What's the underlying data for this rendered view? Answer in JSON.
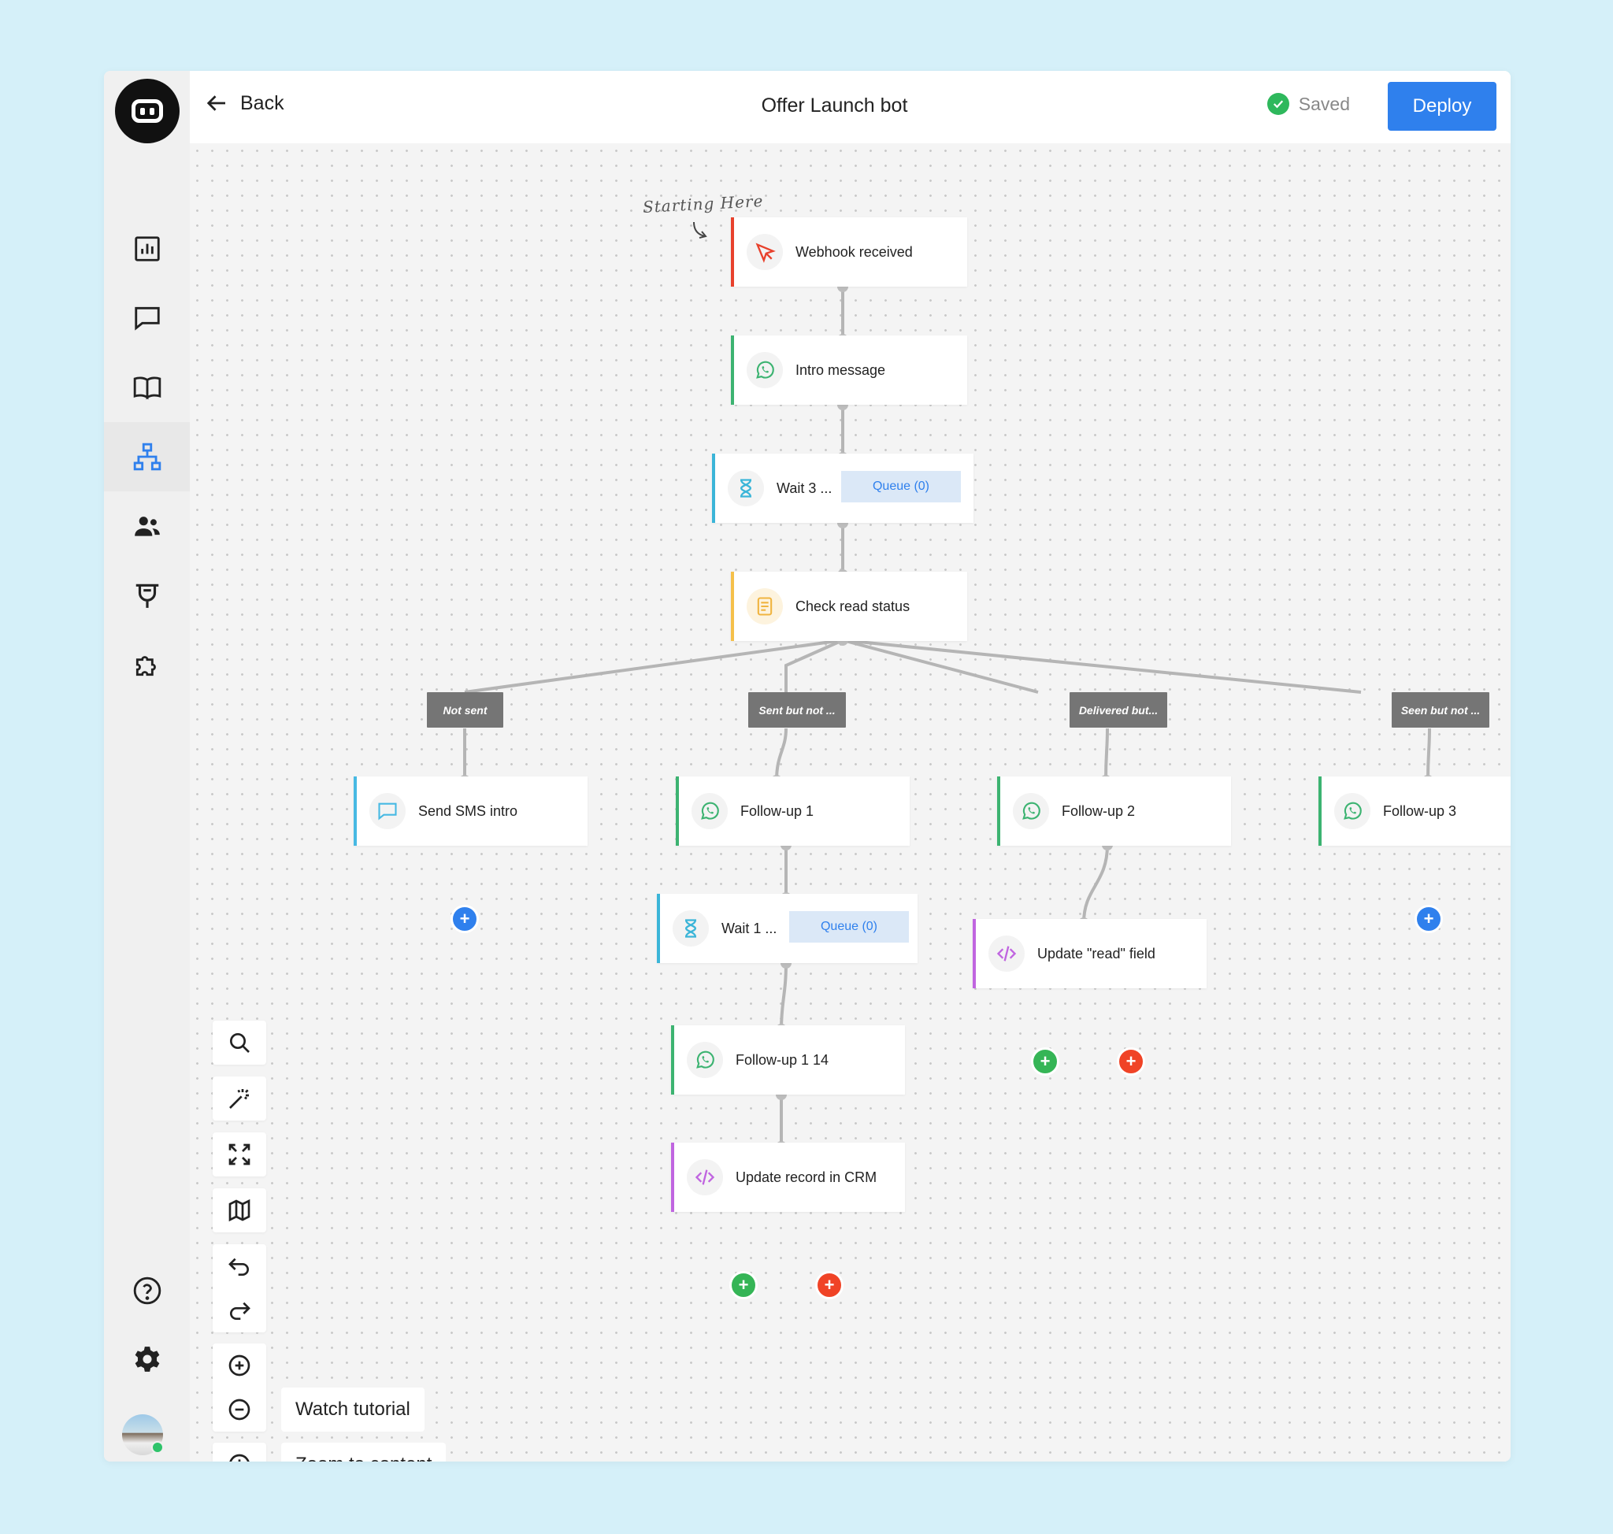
{
  "header": {
    "back_label": "Back",
    "title": "Offer Launch bot",
    "status": "Saved",
    "deploy_label": "Deploy"
  },
  "sidebar": {
    "items": [
      {
        "icon": "analytics-icon"
      },
      {
        "icon": "chat-icon"
      },
      {
        "icon": "book-icon"
      },
      {
        "icon": "flow-icon",
        "active": true
      },
      {
        "icon": "contacts-icon"
      },
      {
        "icon": "plug-icon"
      },
      {
        "icon": "puzzle-icon"
      }
    ],
    "bottom": [
      {
        "icon": "help-icon"
      },
      {
        "icon": "settings-icon"
      }
    ]
  },
  "canvas": {
    "annotation": "Starting Here",
    "nodes": {
      "webhook": {
        "label": "Webhook received",
        "icon": "cursor-icon"
      },
      "intro": {
        "label": "Intro message",
        "icon": "whatsapp-icon"
      },
      "wait3": {
        "label": "Wait 3 ...",
        "queue": "Queue (0)",
        "icon": "hourglass-icon"
      },
      "check": {
        "label": "Check read status",
        "icon": "document-icon"
      },
      "sms": {
        "label": "Send SMS intro",
        "icon": "message-icon"
      },
      "fu1": {
        "label": "Follow-up 1",
        "icon": "whatsapp-icon"
      },
      "fu2": {
        "label": "Follow-up 2",
        "icon": "whatsapp-icon"
      },
      "fu3": {
        "label": "Follow-up 3",
        "icon": "whatsapp-icon"
      },
      "wait1": {
        "label": "Wait 1 ...",
        "queue": "Queue (0)",
        "icon": "hourglass-icon"
      },
      "fu114": {
        "label": "Follow-up 1 14",
        "icon": "whatsapp-icon"
      },
      "crm": {
        "label": "Update record in CRM",
        "icon": "code-icon"
      },
      "readfield": {
        "label": "Update \"read\" field",
        "icon": "code-icon"
      }
    },
    "branches": [
      "Not sent",
      "Sent but not ...",
      "Delivered but...",
      "Seen but not ..."
    ]
  },
  "toolbar": {
    "watch_tutorial": "Watch tutorial",
    "zoom_to_content": "Zoom to content"
  },
  "colors": {
    "accent": "#2f80ed",
    "saved": "#2eb85c",
    "trigger": "#e8412c",
    "whatsapp": "#3cb371",
    "wait": "#3bb5d8",
    "condition": "#f5c04a",
    "code": "#c065e0",
    "sms": "#47b9e3"
  }
}
